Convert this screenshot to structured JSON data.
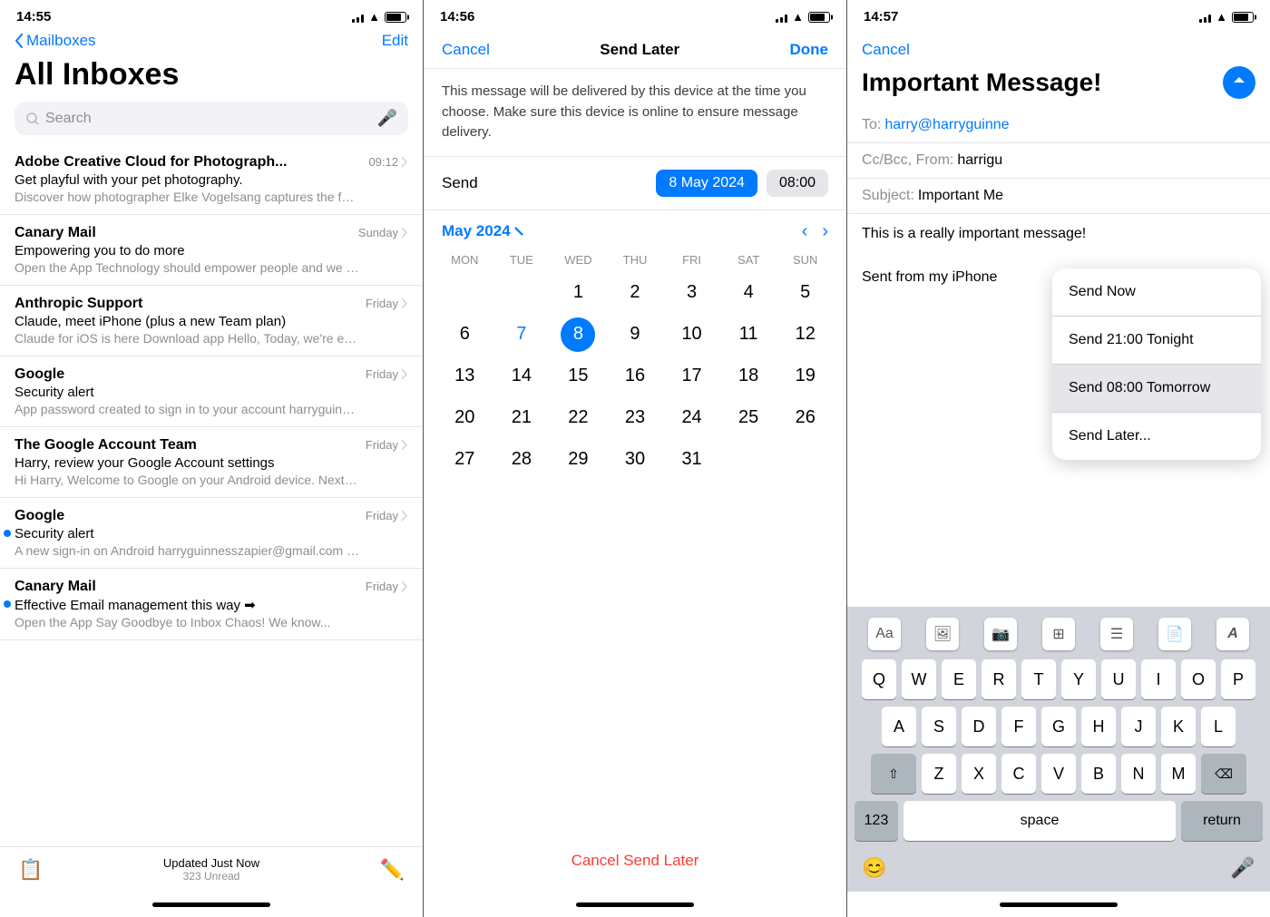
{
  "screen1": {
    "status_time": "14:55",
    "nav": {
      "back_label": "Mailboxes",
      "edit_label": "Edit"
    },
    "title": "All Inboxes",
    "search_placeholder": "Search",
    "emails": [
      {
        "sender": "Adobe Creative Cloud for Photograph...",
        "time": "09:12",
        "subject": "Get playful with your pet photography.",
        "preview": "Discover how photographer Elke Vogelsang captures the feeling of the pets. Bring out the star in your pet....",
        "unread": false
      },
      {
        "sender": "Canary Mail",
        "time": "Sunday",
        "subject": "Empowering you to do more",
        "preview": "Open the App Technology should empower people and we want to help you achieve more. Canary's mission i...",
        "unread": false
      },
      {
        "sender": "Anthropic Support",
        "time": "Friday",
        "subject": "Claude, meet iPhone (plus a new Team plan)",
        "preview": "Claude for iOS is here Download app Hello, Today, we're excited to announce the launch of the Claude i...",
        "unread": false
      },
      {
        "sender": "Google",
        "time": "Friday",
        "subject": "Security alert",
        "preview": "App password created to sign in to your account harryguinnesszapier@gmail.com If you didn't generat...",
        "unread": false
      },
      {
        "sender": "The Google Account Team",
        "time": "Friday",
        "subject": "Harry, review your Google Account settings",
        "preview": "Hi Harry, Welcome to Google on your Android device. Next, take these two steps to confirm your Google Ac...",
        "unread": false
      },
      {
        "sender": "Google",
        "time": "Friday",
        "subject": "Security alert",
        "preview": "A new sign-in on Android harryguinnesszapier@gmail.com We noticed a new si...",
        "unread": true
      },
      {
        "sender": "Canary Mail",
        "time": "Friday",
        "subject": "Effective Email management this way ➡",
        "preview": "Open the App Say Goodbye to Inbox Chaos! We know...",
        "unread": true
      }
    ],
    "bottom": {
      "updated_label": "Updated Just Now",
      "unread_count": "323 Unread"
    }
  },
  "screen2": {
    "status_time": "14:56",
    "nav": {
      "cancel_label": "Cancel",
      "title": "Send Later",
      "done_label": "Done"
    },
    "description": "This message will be delivered by this device at the time you choose. Make sure this device is online to ensure message delivery.",
    "send_label": "Send",
    "date_value": "8 May 2024",
    "time_value": "08:00",
    "calendar": {
      "month_year": "May 2024",
      "day_headers": [
        "MON",
        "TUE",
        "WED",
        "THU",
        "FRI",
        "SAT",
        "SUN"
      ],
      "weeks": [
        [
          "",
          "",
          "1",
          "2",
          "3",
          "4",
          "5"
        ],
        [
          "6",
          "7",
          "8",
          "9",
          "10",
          "11",
          "12"
        ],
        [
          "13",
          "14",
          "15",
          "16",
          "17",
          "18",
          "19"
        ],
        [
          "20",
          "21",
          "22",
          "23",
          "24",
          "25",
          "26"
        ],
        [
          "27",
          "28",
          "29",
          "30",
          "31",
          "",
          ""
        ]
      ]
    },
    "cancel_send_later": "Cancel Send Later"
  },
  "screen3": {
    "status_time": "14:57",
    "cancel_label": "Cancel",
    "compose_title": "Important Message!",
    "to_label": "To:",
    "to_value": "harry@harryguinne",
    "cc_label": "Cc/Bcc, From:",
    "cc_value": "harrigu",
    "subject_label": "Subject:",
    "subject_value": "Important Me",
    "body_line1": "This is a really important message!",
    "body_line2": "",
    "body_line3": "Sent from my iPhone",
    "dropdown": {
      "items": [
        {
          "label": "Send Now",
          "highlighted": false
        },
        {
          "label": "Send 21:00 Tonight",
          "highlighted": false
        },
        {
          "label": "Send 08:00 Tomorrow",
          "highlighted": true
        },
        {
          "label": "Send Later...",
          "highlighted": false
        }
      ]
    },
    "keyboard": {
      "toolbar_icons": [
        "Aa",
        "🖼",
        "📷",
        "🔲",
        "☰",
        "📄",
        "A"
      ],
      "row1": [
        "Q",
        "W",
        "E",
        "R",
        "T",
        "Y",
        "U",
        "I",
        "O",
        "P"
      ],
      "row2": [
        "A",
        "S",
        "D",
        "F",
        "G",
        "H",
        "J",
        "K",
        "L"
      ],
      "row3": [
        "Z",
        "X",
        "C",
        "V",
        "B",
        "N",
        "M"
      ],
      "key_123": "123",
      "key_space": "space",
      "key_return": "return"
    }
  },
  "colors": {
    "blue": "#007AFF",
    "red": "#FF3B30",
    "gray": "#8E8E93",
    "light_gray": "#F2F2F7"
  }
}
